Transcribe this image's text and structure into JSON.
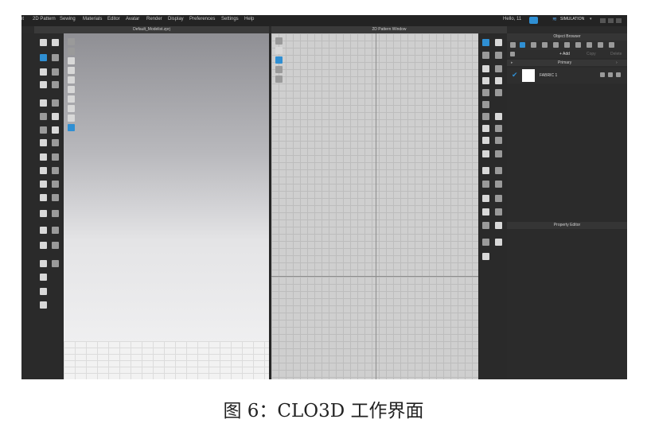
{
  "menu": [
    "nt",
    "2D Pattern",
    "Sewing",
    "Materials",
    "Editor",
    "Avatar",
    "Render",
    "Display",
    "Preferences",
    "Settings",
    "Help"
  ],
  "user": {
    "greeting": "Hello, 11"
  },
  "mode": {
    "label": "SIMULATION"
  },
  "viewport3d": {
    "title": "Default_Modelist.zprj"
  },
  "pattern2d": {
    "title": "2D Pattern Window"
  },
  "object_browser": {
    "title": "Object Browser",
    "add_label": "+ Add",
    "copy_label": "Copy",
    "delete_label": "Delete",
    "primary_label": "Primary",
    "fabric_name": "FABRIC 1",
    "checkmark": "✔"
  },
  "property_editor": {
    "title": "Property Editor"
  },
  "caption": "图 6：CLO3D 工作界面"
}
